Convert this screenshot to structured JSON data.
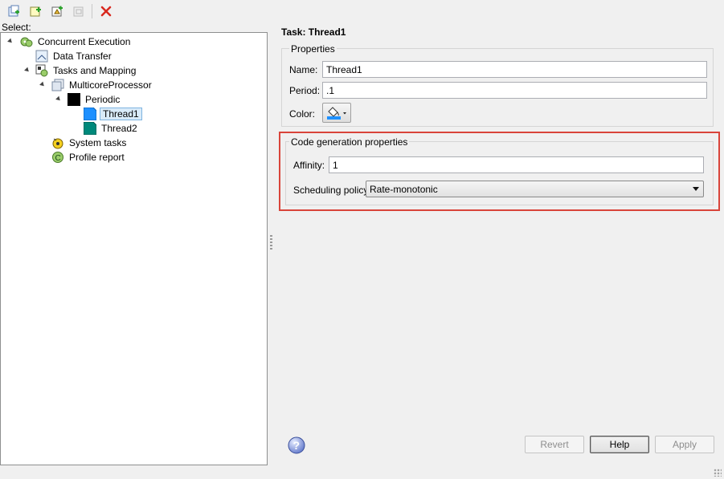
{
  "toolbar": {
    "buttons": [
      {
        "icon": "add-task-icon",
        "enabled": true
      },
      {
        "icon": "add-periodic-trigger-icon",
        "enabled": true
      },
      {
        "icon": "add-aperiodic-trigger-icon",
        "enabled": true
      },
      {
        "icon": "add-task-group-icon",
        "enabled": false
      },
      {
        "icon": "delete-icon",
        "enabled": true
      }
    ]
  },
  "left": {
    "select_label": "Select:",
    "tree": [
      {
        "label": "Concurrent Execution",
        "icon": "concurrent-execution-icon",
        "expanded": true
      },
      {
        "label": "Data Transfer",
        "icon": "data-transfer-icon"
      },
      {
        "label": "Tasks and Mapping",
        "icon": "tasks-mapping-icon",
        "expanded": true
      },
      {
        "label": "MulticoreProcessor",
        "icon": "processor-icon",
        "expanded": true
      },
      {
        "label": "Periodic",
        "icon": "periodic-trigger-icon",
        "expanded": true
      },
      {
        "label": "Thread1",
        "icon": "task-color-icon",
        "color": "#1e90ff",
        "selected": true
      },
      {
        "label": "Thread2",
        "icon": "task-color-icon",
        "color": "#00897b"
      },
      {
        "label": "System tasks",
        "icon": "system-tasks-icon"
      },
      {
        "label": "Profile report",
        "icon": "profile-report-icon"
      }
    ]
  },
  "right": {
    "title": "Task: Thread1",
    "properties": {
      "legend": "Properties",
      "name_label": "Name:",
      "name_value": "Thread1",
      "period_label": "Period:",
      "period_value": ".1",
      "color_label": "Color:",
      "color_value": "#1e90ff"
    },
    "codegen": {
      "legend": "Code generation properties",
      "affinity_label": "Affinity:",
      "affinity_value": "1",
      "policy_label": "Scheduling policy:",
      "policy_value": "Rate-monotonic"
    },
    "buttons": {
      "revert": "Revert",
      "help": "Help",
      "apply": "Apply"
    }
  },
  "colors": {
    "highlight": "#d9443a",
    "selection": "#d9ebf9"
  }
}
